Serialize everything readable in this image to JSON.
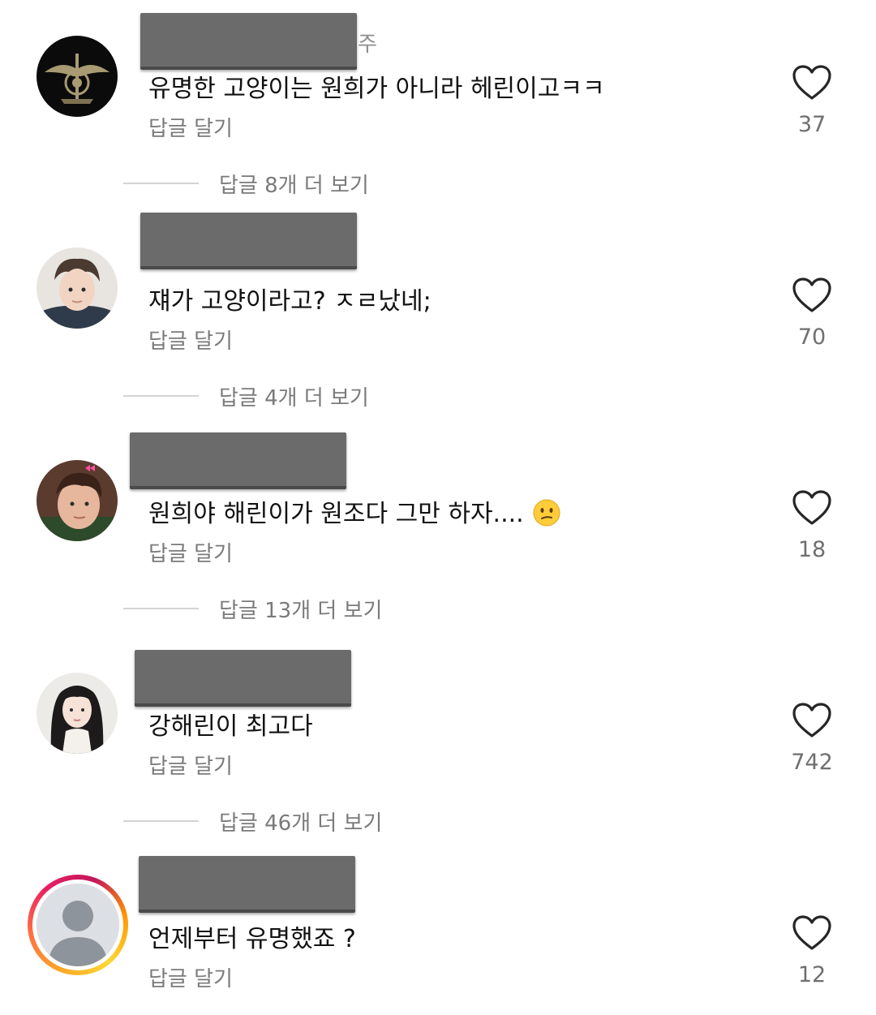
{
  "comments": [
    {
      "username_suffix": "주",
      "text": "유명한 고양이는 원희가 아니라 헤린이고ㅋㅋ",
      "reply_label": "답글 달기",
      "likes": "37",
      "avatar": "seal-emblem-avatar",
      "more_replies": "답글 8개 더 보기"
    },
    {
      "username_suffix": "",
      "text": "쟤가 고양이라고? ㅈㄹ났네;",
      "reply_label": "답글 달기",
      "likes": "70",
      "avatar": "person-avatar",
      "more_replies": "답글 4개 더 보기"
    },
    {
      "username_suffix": "",
      "text": "원희야 해린이가 원조다 그만 하자....",
      "emoji": "confused-face-emoji",
      "reply_label": "답글 달기",
      "likes": "18",
      "avatar": "person-avatar",
      "more_replies": "답글 13개 더 보기"
    },
    {
      "username_suffix": "",
      "text": "강해린이 최고다",
      "reply_label": "답글 달기",
      "likes": "742",
      "avatar": "person-avatar",
      "more_replies": "답글 46개 더 보기"
    },
    {
      "username_suffix": "",
      "text": "언제부터 유명했죠 ?",
      "reply_label": "답글 달기",
      "likes": "12",
      "avatar": "default-profile-avatar-with-story-ring"
    }
  ],
  "icons": {
    "like": "heart-outline-icon"
  },
  "colors": {
    "text": "#111111",
    "secondary": "#7a7a7a",
    "redaction": "#6b6b6b",
    "story_ring": "#e91e63"
  }
}
